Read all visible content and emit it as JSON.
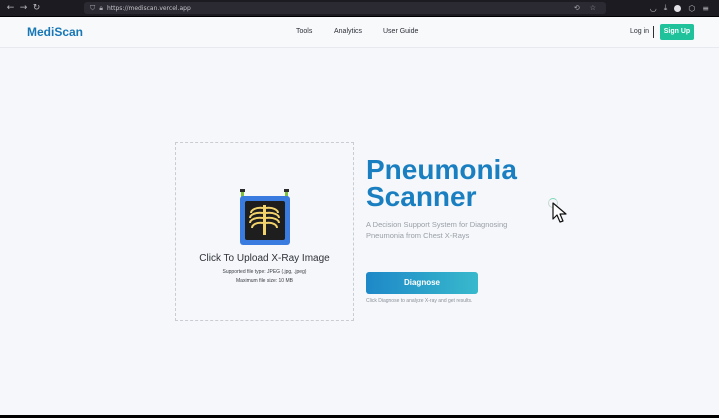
{
  "browser": {
    "url": "https://mediscan.vercel.app",
    "back_icon": "back-arrow-icon",
    "forward_icon": "forward-arrow-icon",
    "reload_icon": "reload-icon"
  },
  "header": {
    "logo": "MediScan",
    "nav": [
      "Tools",
      "Analytics",
      "User Guide"
    ],
    "login": "Log in",
    "signup": "Sign Up"
  },
  "upload": {
    "title": "Click To Upload X-Ray Image",
    "supported": "Supported file type: JPEG (.jpg, .jpeg)",
    "max_size": "Maximum file size: 10 MB",
    "icon": "xray-icon"
  },
  "hero": {
    "title_line1": "Pneumonia",
    "title_line2": "Scanner",
    "description": "A Decision Support System for Diagnosing Pneumonia from Chest X-Rays",
    "button": "Diagnose",
    "hint": "Click Diagnose to analyze X-ray and get results."
  },
  "colors": {
    "brand": "#1877b5",
    "signup": "#1fc29a",
    "title": "#1a7fc0"
  }
}
